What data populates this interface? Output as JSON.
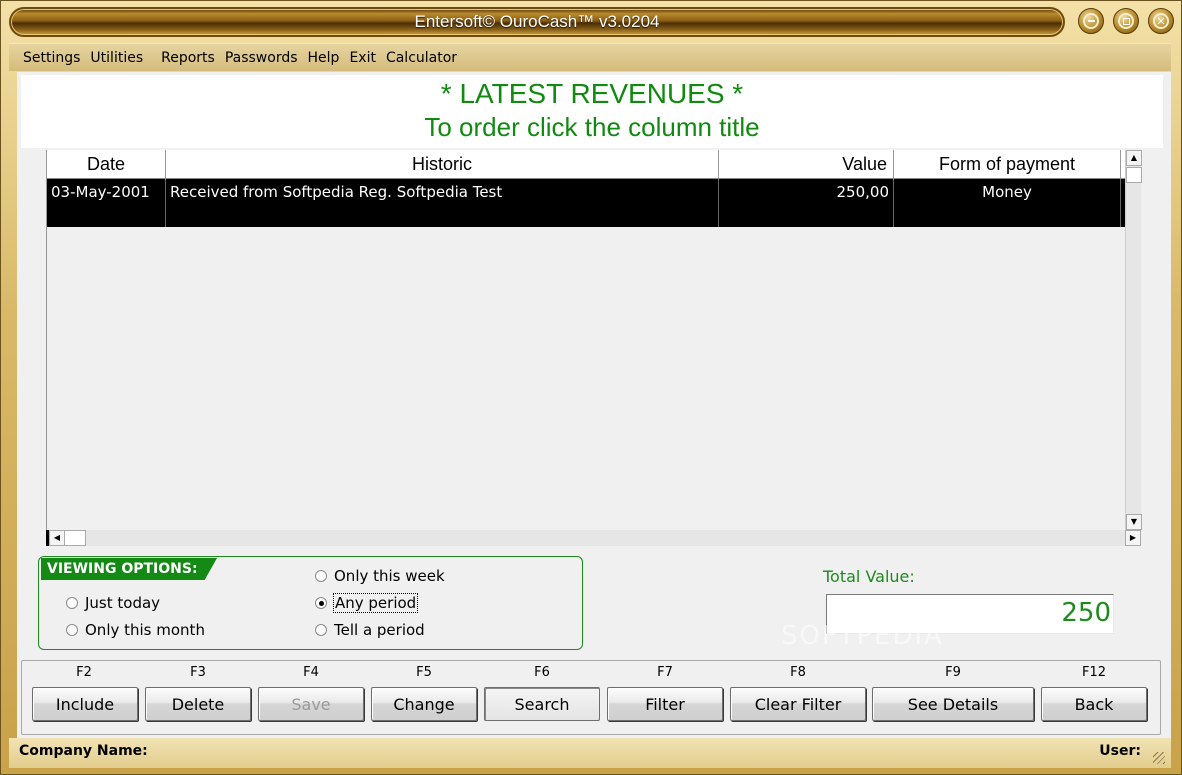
{
  "window": {
    "title": "Entersoft© OuroCash™ v3.0204",
    "controls": [
      "minimize-icon",
      "maximize-icon",
      "close-icon"
    ]
  },
  "menu": {
    "items": [
      "Settings",
      "Utilities",
      "Reports",
      "Passwords",
      "Help",
      "Exit",
      "Calculator"
    ]
  },
  "header": {
    "title": "* LATEST REVENUES *",
    "subtitle": "To order click the column title"
  },
  "table": {
    "columns": [
      "Date",
      "Historic",
      "Value",
      "Form of payment"
    ],
    "rows": [
      {
        "date": "03-May-2001",
        "historic": "Received from Softpedia Reg. Softpedia Test",
        "value": "250,00",
        "form": "Money"
      }
    ]
  },
  "viewing_options": {
    "label": "VIEWING OPTIONS:",
    "options": [
      {
        "label": "Just today",
        "selected": false
      },
      {
        "label": "Only this month",
        "selected": false
      },
      {
        "label": "Only this week",
        "selected": false
      },
      {
        "label": "Any period",
        "selected": true
      },
      {
        "label": "Tell a period",
        "selected": false
      }
    ]
  },
  "total": {
    "label": "Total Value:",
    "value": "250"
  },
  "buttons": [
    {
      "key": "F2",
      "label": "Include",
      "enabled": true
    },
    {
      "key": "F3",
      "label": "Delete",
      "enabled": true
    },
    {
      "key": "F4",
      "label": "Save",
      "enabled": false
    },
    {
      "key": "F5",
      "label": "Change",
      "enabled": true
    },
    {
      "key": "F6",
      "label": "Search",
      "enabled": true
    },
    {
      "key": "F7",
      "label": "Filter",
      "enabled": true
    },
    {
      "key": "F8",
      "label": "Clear Filter",
      "enabled": true
    },
    {
      "key": "F9",
      "label": "See Details",
      "enabled": true
    },
    {
      "key": "F12",
      "label": "Back",
      "enabled": true
    }
  ],
  "status": {
    "company_label": "Company Name:",
    "user_label": "User:"
  },
  "watermark": "SOFTPEDIA",
  "colors": {
    "accent_green": "#128a12",
    "frame_gold": "#c9a24a",
    "row_selected_bg": "#000000"
  }
}
